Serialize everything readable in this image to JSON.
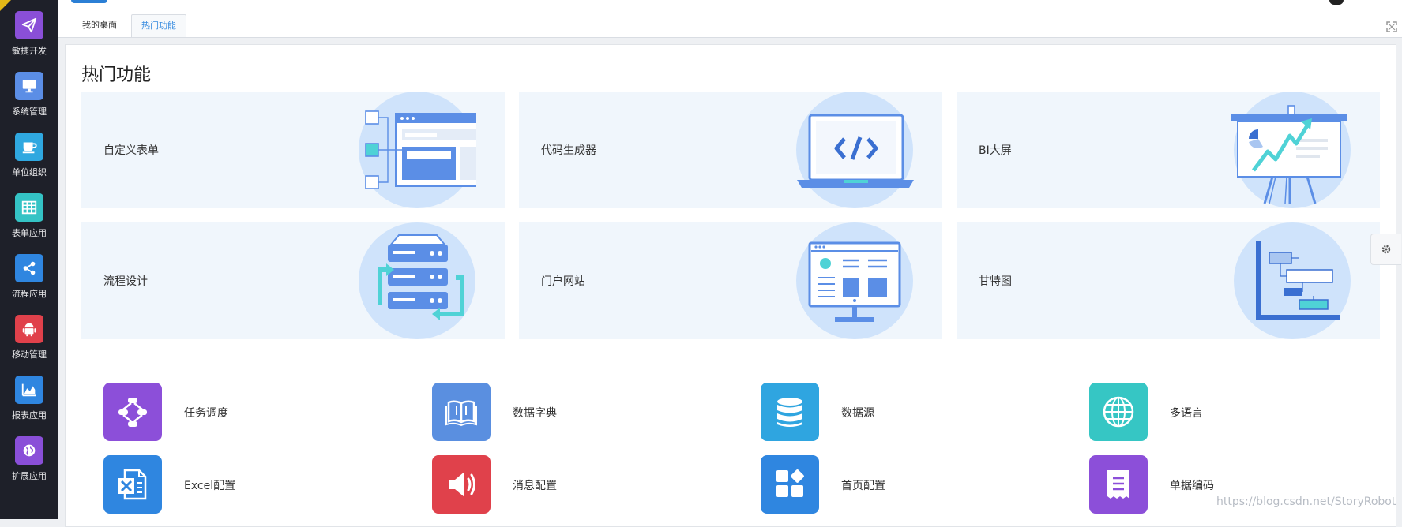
{
  "sidebar": {
    "items": [
      {
        "label": "敏捷开发",
        "icon": "paper-plane-icon",
        "color": "#8a4fd8"
      },
      {
        "label": "系统管理",
        "icon": "monitor-icon",
        "color": "#5b8ee6"
      },
      {
        "label": "单位组织",
        "icon": "coffee-cup-icon",
        "color": "#2fa8e0"
      },
      {
        "label": "表单应用",
        "icon": "table-grid-icon",
        "color": "#34c3c5"
      },
      {
        "label": "流程应用",
        "icon": "share-nodes-icon",
        "color": "#2f86e0"
      },
      {
        "label": "移动管理",
        "icon": "android-icon",
        "color": "#e0414b"
      },
      {
        "label": "报表应用",
        "icon": "area-chart-icon",
        "color": "#2f86e0"
      },
      {
        "label": "扩展应用",
        "icon": "globe-icon",
        "color": "#8a4fd8"
      }
    ]
  },
  "tabs": [
    {
      "label": "我的桌面",
      "active": false
    },
    {
      "label": "热门功能",
      "active": true
    }
  ],
  "panel": {
    "title": "热门功能",
    "cards": [
      {
        "label": "自定义表单",
        "icon": "form-builder-icon"
      },
      {
        "label": "代码生成器",
        "icon": "laptop-code-icon"
      },
      {
        "label": "BI大屏",
        "icon": "presentation-chart-icon"
      },
      {
        "label": "流程设计",
        "icon": "server-flow-icon"
      },
      {
        "label": "门户网站",
        "icon": "desktop-portal-icon"
      },
      {
        "label": "甘特图",
        "icon": "gantt-chart-icon"
      }
    ],
    "features": [
      {
        "label": "任务调度",
        "icon": "task-flow-icon",
        "color": "#8c4fd9"
      },
      {
        "label": "数据字典",
        "icon": "open-book-icon",
        "color": "#5a8fe0"
      },
      {
        "label": "数据源",
        "icon": "database-icon",
        "color": "#2fa5e0"
      },
      {
        "label": "多语言",
        "icon": "globe-grid-icon",
        "color": "#36c6c4"
      },
      {
        "label": "Excel配置",
        "icon": "excel-file-icon",
        "color": "#2f86e0"
      },
      {
        "label": "消息配置",
        "icon": "speaker-icon",
        "color": "#e0414b"
      },
      {
        "label": "首页配置",
        "icon": "blocks-icon",
        "color": "#2f86e0"
      },
      {
        "label": "单据编码",
        "icon": "receipt-icon",
        "color": "#8c4fd9"
      }
    ]
  },
  "watermark": "https://blog.csdn.net/StoryRobot"
}
